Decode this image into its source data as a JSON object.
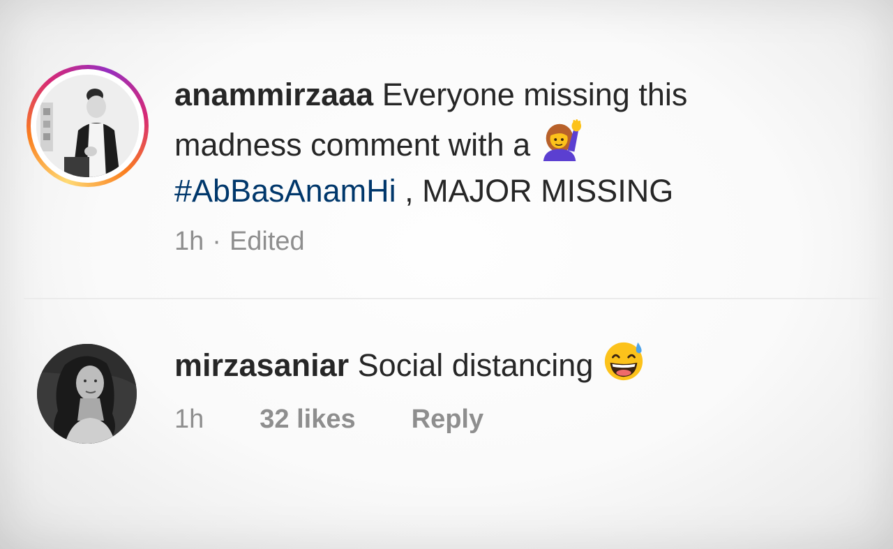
{
  "comments": [
    {
      "username": "anammirzaaa",
      "text_line1": "Everyone missing this",
      "text_line2": "madness comment with a",
      "emoji": "raising-hand-woman-emoji",
      "hashtag": "#AbBasAnamHi",
      "text_after_hashtag": " , MAJOR MISSING",
      "time": "1h",
      "separator": "·",
      "edited_label": "Edited",
      "has_story_ring": true
    },
    {
      "username": "mirzasaniar",
      "text": "Social distancing",
      "emoji": "grinning-sweat-emoji",
      "time": "1h",
      "likes": "32 likes",
      "reply_label": "Reply"
    }
  ],
  "colors": {
    "text": "#262626",
    "meta": "#8e8e8e",
    "hashtag": "#00376b",
    "divider": "#ebebeb"
  }
}
